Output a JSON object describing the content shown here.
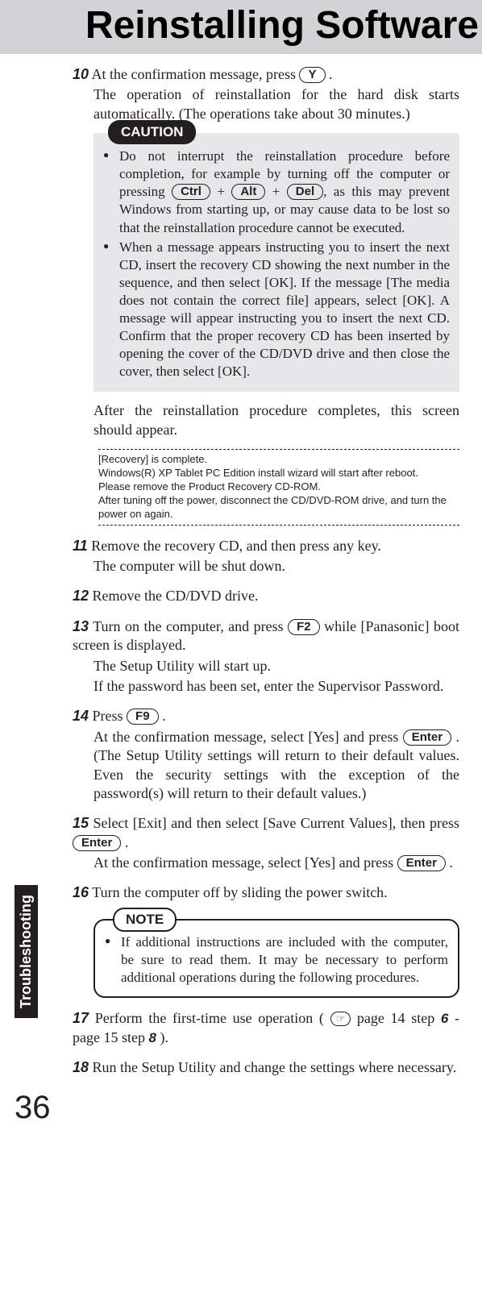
{
  "header": {
    "title": "Reinstalling Software"
  },
  "sideTab": "Troubleshooting",
  "pageNumber": "36",
  "keys": {
    "Y": "Y",
    "Ctrl": "Ctrl",
    "Alt": "Alt",
    "Del": "Del",
    "F2": "F2",
    "F9": "F9",
    "Enter": "Enter"
  },
  "labels": {
    "caution": "CAUTION",
    "note": "NOTE",
    "refIcon": "☞"
  },
  "steps": {
    "s10": {
      "num": "10",
      "line1a": "At the confirmation message, press ",
      "line1b": " .",
      "line2": "The operation of reinstallation for the hard disk starts automatically. (The operations take about 30 minutes.)"
    },
    "caution": {
      "b1a": "Do not interrupt the reinstallation procedure before completion, for example by turning off the computer or pressing  ",
      "b1b": " + ",
      "b1c": " + ",
      "b1d": ", as this may prevent Windows from starting up, or may cause data to be lost so that the reinstallation procedure  cannot be executed.",
      "b2": "When a message appears instructing you to insert the next CD, insert the recovery CD showing the next number in the sequence, and then select [OK]. If the message [The media does not contain the correct file] appears, select [OK]. A message will appear instructing you to insert the next CD. Confirm that the proper recovery CD has been inserted by opening the cover of the CD/DVD drive and then close the cover, then select [OK]."
    },
    "afterCaution": "After the reinstallation procedure completes, this screen should appear.",
    "message": {
      "l1": "[Recovery] is complete.",
      "l2": "Windows(R) XP Tablet PC Edition install wizard will start after reboot.",
      "l3": "Please remove the Product Recovery CD-ROM.",
      "l4": "After tuning off the power, disconnect the CD/DVD-ROM drive, and turn the power on again."
    },
    "s11": {
      "num": "11",
      "line1": "Remove the recovery CD, and then press any key.",
      "line2": "The computer will be shut down."
    },
    "s12": {
      "num": "12",
      "line1": "Remove the CD/DVD drive."
    },
    "s13": {
      "num": "13",
      "line1a": "Turn on the computer, and press ",
      "line1b": " while [Panasonic] boot screen is displayed.",
      "line2": "The Setup Utility will start up.",
      "line3": "If the password has been set, enter the Supervisor Password."
    },
    "s14": {
      "num": "14",
      "line1a": "Press ",
      "line1b": " .",
      "line2a": "At the confirmation message, select [Yes] and press ",
      "line2b": " .  (The Setup Utility settings will return to their default values.  Even the security settings with the exception of the password(s) will return to their default values.)"
    },
    "s15": {
      "num": "15",
      "line1a": "Select [Exit] and then select [Save Current Values], then press  ",
      "line1b": " .",
      "line2a": "At the confirmation message, select [Yes] and press ",
      "line2b": " ."
    },
    "s16": {
      "num": "16",
      "line1": "Turn the computer off by sliding the power switch."
    },
    "note": {
      "b1": "If additional instructions are included with the computer, be sure to read them. It may be necessary to perform additional operations during the following procedures."
    },
    "s17": {
      "num": "17",
      "line1a": "Perform the first-time use operation ( ",
      "line1b": " page 14 step ",
      "boldA": "6",
      "line1c": " - page 15 step ",
      "boldB": "8",
      "line1d": " )."
    },
    "s18": {
      "num": "18",
      "line1": "Run the Setup Utility and change the settings where necessary."
    }
  }
}
